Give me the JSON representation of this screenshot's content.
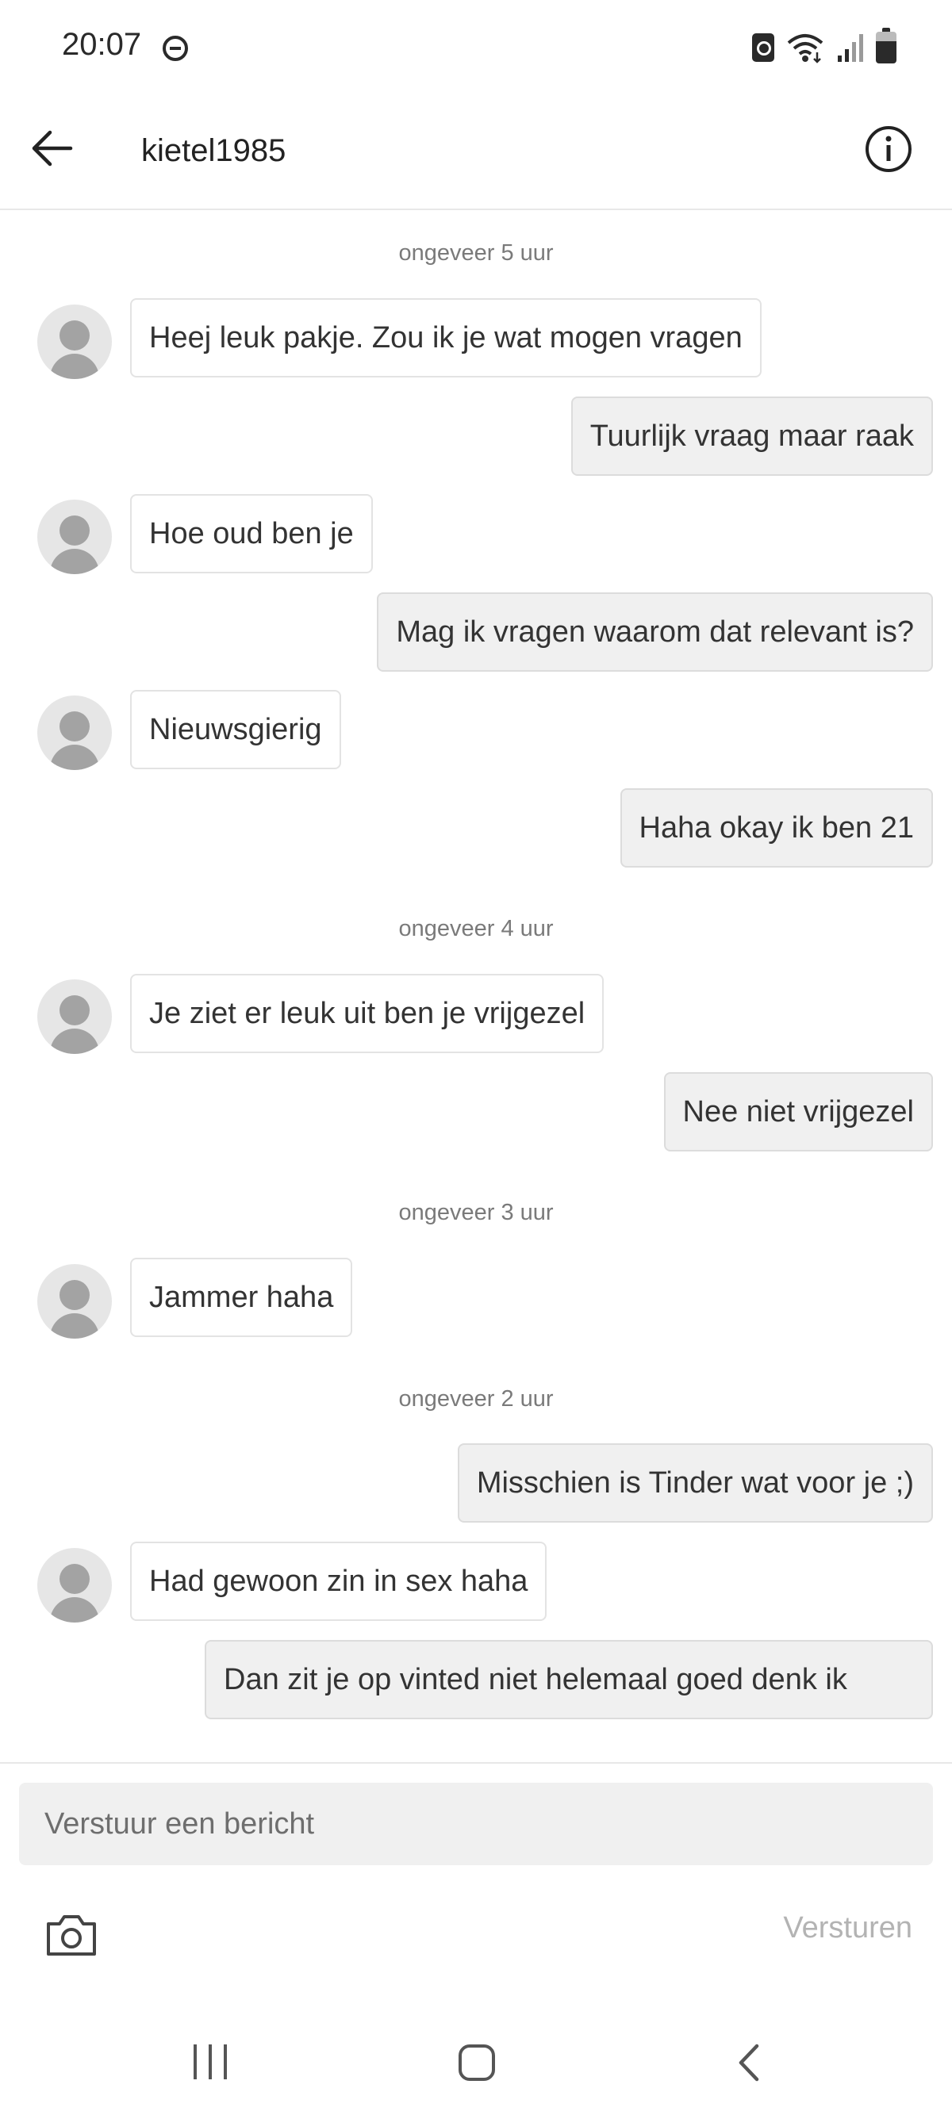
{
  "status_bar": {
    "time": "20:07",
    "icons": [
      "do-not-disturb-icon",
      "recycle-icon",
      "wifi-icon",
      "signal-icon",
      "battery-icon"
    ]
  },
  "header": {
    "title": "kietel1985",
    "back_icon": "arrow-left-icon",
    "info_icon": "info-circle-icon"
  },
  "messages": {
    "ts1": "ongeveer 5 uur",
    "m1": "Heej leuk pakje. Zou ik je wat mogen vragen",
    "m2": "Tuurlijk vraag maar raak",
    "m3": "Hoe oud ben je",
    "m4": "Mag ik vragen waarom dat relevant is?",
    "m5": "Nieuwsgierig",
    "m6": "Haha okay ik ben 21",
    "ts2": "ongeveer 4 uur",
    "m7": "Je ziet er leuk uit ben je vrijgezel",
    "m8": "Nee niet vrijgezel",
    "ts3": "ongeveer 3 uur",
    "m9": "Jammer haha",
    "ts4": "ongeveer 2 uur",
    "m10": "Misschien is Tinder wat voor je ;)",
    "m11": "Had gewoon zin in sex haha",
    "m12": "Dan zit je op vinted niet helemaal goed denk ik"
  },
  "composer": {
    "placeholder": "Verstuur een bericht",
    "send_label": "Versturen",
    "camera_icon": "camera-icon"
  },
  "nav_bar": {
    "icons": [
      "recent-apps-icon",
      "home-icon",
      "back-icon"
    ]
  },
  "colors": {
    "incoming_bubble": "#ffffff",
    "outgoing_bubble": "#f0f0f0",
    "send_disabled": "#b3b3b3",
    "timestamp": "#7a7a7a"
  }
}
